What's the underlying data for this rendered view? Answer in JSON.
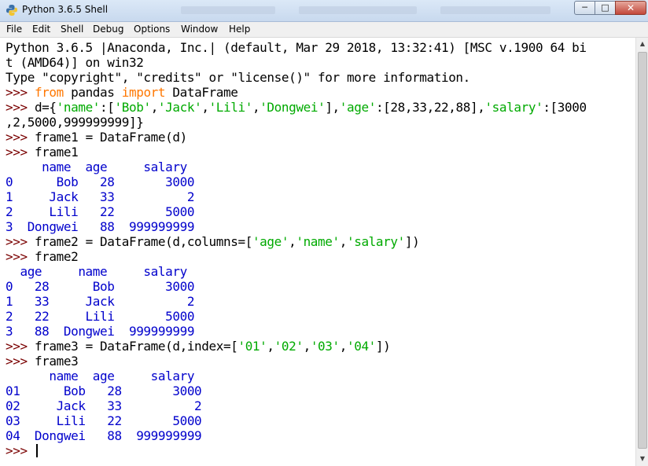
{
  "window": {
    "title": "Python 3.6.5 Shell",
    "controls": {
      "minimize": "─",
      "maximize": "□",
      "close": "✕"
    }
  },
  "menu": [
    "File",
    "Edit",
    "Shell",
    "Debug",
    "Options",
    "Window",
    "Help"
  ],
  "colors": {
    "prompt": "#7a0000",
    "keyword": "#ff7700",
    "string": "#00aa00",
    "output": "#0000cc"
  },
  "console": {
    "banner": [
      "Python 3.6.5 |Anaconda, Inc.| (default, Mar 29 2018, 13:32:41) [MSC v.1900 64 bi",
      "t (AMD64)] on win32",
      "Type \"copyright\", \"credits\" or \"license()\" for more information."
    ],
    "prompt": ">>> ",
    "cmd1": {
      "kw_from": "from",
      "module": " pandas ",
      "kw_import": "import",
      "name": " DataFrame"
    },
    "cmd2": {
      "a": "d={",
      "s1": "'name'",
      "b": ":[",
      "s2": "'Bob'",
      "c": ",",
      "s3": "'Jack'",
      "d": ",",
      "s4": "'Lili'",
      "e": ",",
      "s5": "'Dongwei'",
      "f": "],",
      "s6": "'age'",
      "g": ":[28,33,22,88],",
      "s7": "'salary'",
      "h": ":[3000",
      "wrap": ",2,5000,999999999]}"
    },
    "cmd3": "frame1 = DataFrame(d)",
    "cmd4": "frame1",
    "out1": [
      "     name  age     salary",
      "0      Bob   28       3000",
      "1     Jack   33          2",
      "2     Lili   22       5000",
      "3  Dongwei   88  999999999"
    ],
    "cmd5": {
      "a": "frame2 = DataFrame(d,columns=[",
      "s1": "'age'",
      "b": ",",
      "s2": "'name'",
      "c": ",",
      "s3": "'salary'",
      "d": "])"
    },
    "cmd6": "frame2",
    "out2": [
      "  age     name     salary",
      "0   28      Bob       3000",
      "1   33     Jack          2",
      "2   22     Lili       5000",
      "3   88  Dongwei  999999999"
    ],
    "cmd7": {
      "a": "frame3 = DataFrame(d,index=[",
      "s1": "'01'",
      "b": ",",
      "s2": "'02'",
      "c": ",",
      "s3": "'03'",
      "d": ",",
      "s4": "'04'",
      "e": "])"
    },
    "cmd8": "frame3",
    "out3": [
      "      name  age     salary",
      "01      Bob   28       3000",
      "02     Jack   33          2",
      "03     Lili   22       5000",
      "04  Dongwei   88  999999999"
    ]
  }
}
